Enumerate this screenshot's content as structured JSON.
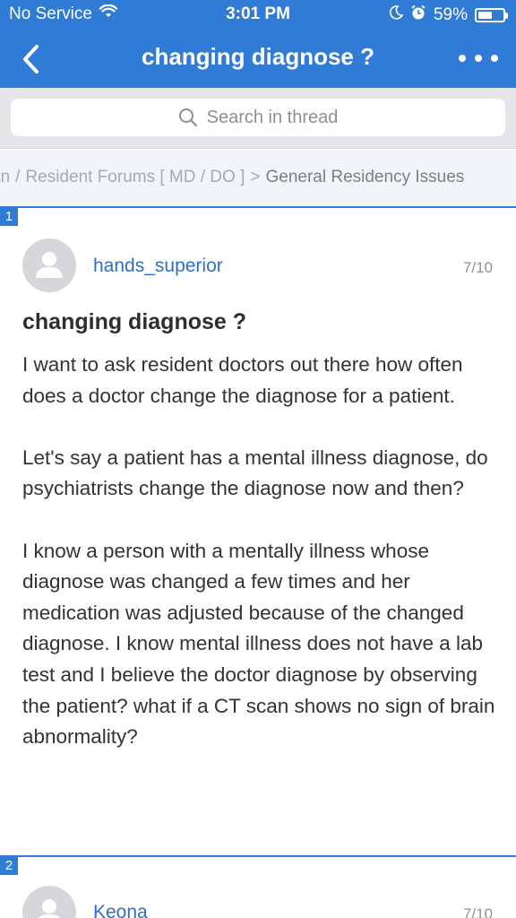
{
  "status_bar": {
    "carrier": "No Service",
    "time": "3:01 PM",
    "battery": "59%",
    "battery_level": 0.59
  },
  "nav": {
    "title": "changing diagnose ?",
    "back_icon": "chevron-left-icon",
    "more_icon": "more-horizontal-icon"
  },
  "search": {
    "placeholder": "Search in thread"
  },
  "breadcrumb": {
    "items": [
      "an",
      "Resident Forums [ MD / DO ]",
      "General Residency Issues"
    ]
  },
  "posts": [
    {
      "number": "1",
      "username": "hands_superior",
      "date": "7/10",
      "title": "changing diagnose ?",
      "paragraphs": [
        "I want to ask resident doctors out there how often does a doctor change the diagnose for a patient.",
        "Let's say a patient has a mental illness diagnose, do psychiatrists change the diagnose now and then?",
        "I know a person with a mentally illness whose diagnose was changed a few times and her medication was adjusted because of the changed diagnose. I know mental illness does not have a lab test and I believe the doctor diagnose by observing the patient? what if a CT scan shows no sign of brain abnormality?"
      ]
    },
    {
      "number": "2",
      "username": "Keona",
      "date": "7/10"
    }
  ],
  "colors": {
    "accent": "#2f7bd6",
    "link": "#2f6fc0"
  }
}
